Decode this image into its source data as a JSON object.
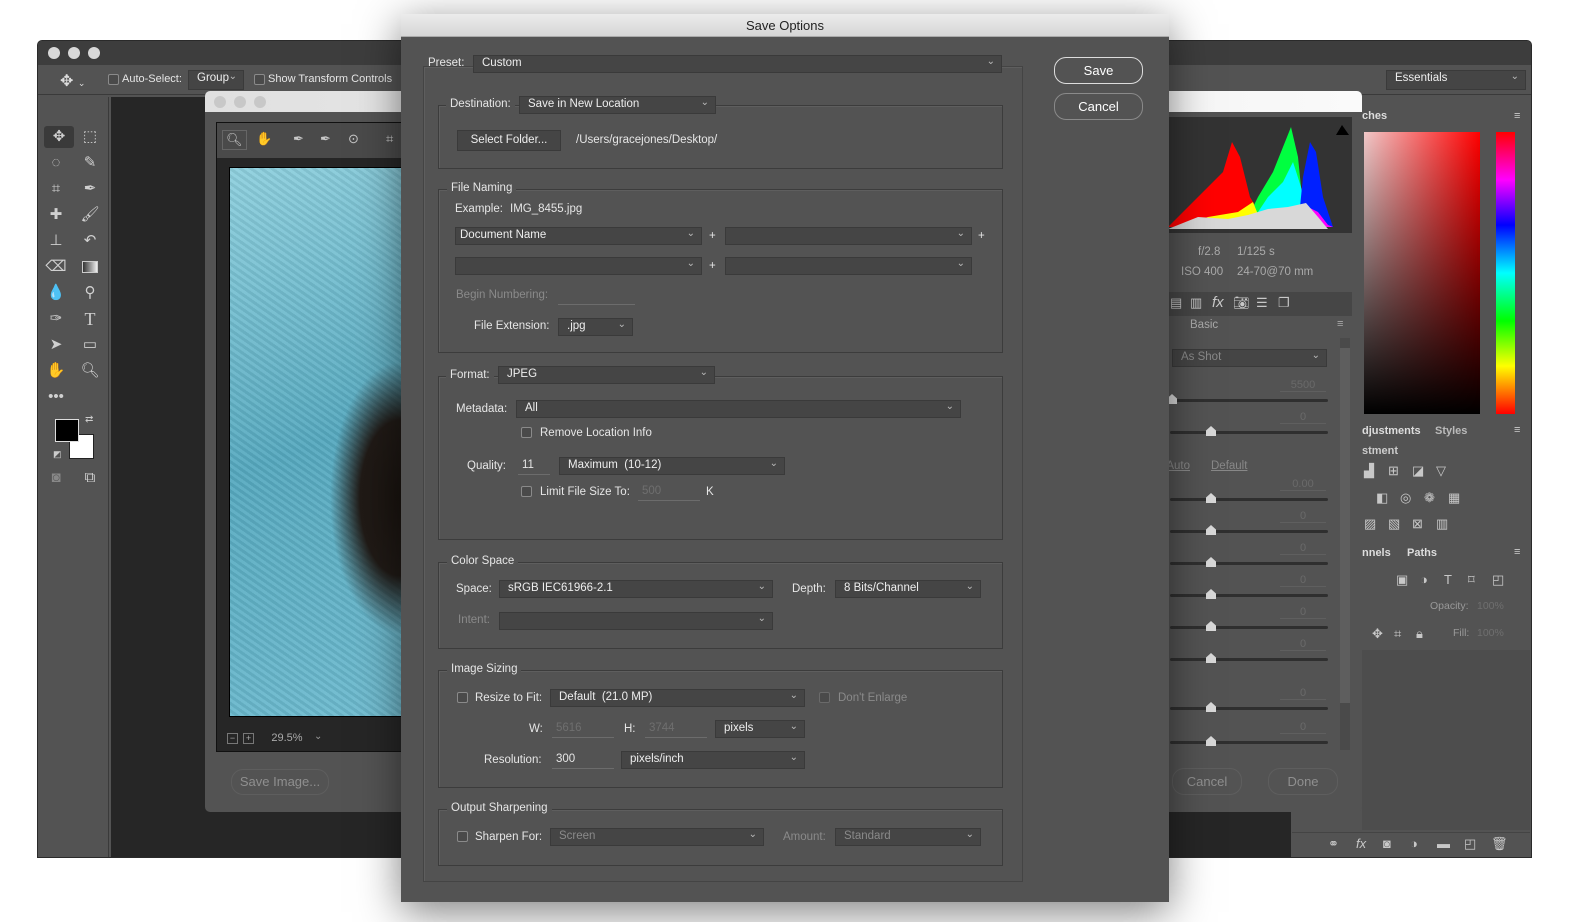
{
  "photoshop": {
    "options_bar": {
      "auto_select_label": "Auto-Select:",
      "auto_select_value": "Group",
      "show_transform_label": "Show Transform Controls",
      "workspace": "Essentials"
    },
    "colors": {
      "foreground": "#000000",
      "background": "#ffffff"
    }
  },
  "camera_raw": {
    "zoom_level": "29.5%",
    "save_image_label": "Save Image...",
    "cancel_label": "Cancel",
    "done_label": "Done",
    "exif": {
      "aperture": "f/2.8",
      "shutter": "1/125 s",
      "iso": "ISO 400",
      "lens": "24-70@70 mm"
    },
    "panel_title": "Basic",
    "white_balance": "As Shot",
    "auto_label": "Auto",
    "default_label": "Default",
    "sliders": [
      {
        "value": "5500",
        "position": 0.0
      },
      {
        "value": "0",
        "position": 0.5
      },
      {
        "value": "0.00",
        "position": 0.5
      },
      {
        "value": "0",
        "position": 0.5
      },
      {
        "value": "0",
        "position": 0.5
      },
      {
        "value": "0",
        "position": 0.5
      },
      {
        "value": "0",
        "position": 0.5
      },
      {
        "value": "0",
        "position": 0.5
      },
      {
        "value": "0",
        "position": 0.5
      },
      {
        "value": "0",
        "position": 0.5
      }
    ]
  },
  "right_panels": {
    "swatches_tab": "ches",
    "adjustments_tab": "djustments",
    "styles_tab": "Styles",
    "adjustment_heading": "stment",
    "channels_tab": "nnels",
    "paths_tab": "Paths",
    "opacity_label": "Opacity:",
    "opacity_value": "100%",
    "fill_label": "Fill:",
    "fill_value": "100%"
  },
  "dialog": {
    "title": "Save Options",
    "save_label": "Save",
    "cancel_label": "Cancel",
    "preset_label": "Preset:",
    "preset_value": "Custom",
    "destination_label": "Destination:",
    "destination_value": "Save in New Location",
    "select_folder_label": "Select Folder...",
    "folder_path": "/Users/gracejones/Desktop/",
    "file_naming": {
      "title": "File Naming",
      "example_label": "Example:",
      "example_value": "IMG_8455.jpg",
      "name_part1": "Document Name",
      "plus": "+",
      "begin_numbering_label": "Begin Numbering:",
      "file_extension_label": "File Extension:",
      "file_extension_value": ".jpg"
    },
    "format": {
      "label": "Format:",
      "value": "JPEG",
      "metadata_label": "Metadata:",
      "metadata_value": "All",
      "remove_location_label": "Remove Location Info",
      "quality_label": "Quality:",
      "quality_value": "11",
      "quality_preset": "Maximum  (10-12)",
      "limit_size_label": "Limit File Size To:",
      "limit_size_value": "500",
      "limit_size_unit": "K"
    },
    "color_space": {
      "title": "Color Space",
      "space_label": "Space:",
      "space_value": "sRGB IEC61966-2.1",
      "depth_label": "Depth:",
      "depth_value": "8 Bits/Channel",
      "intent_label": "Intent:"
    },
    "image_sizing": {
      "title": "Image Sizing",
      "resize_label": "Resize to Fit:",
      "resize_value": "Default  (21.0 MP)",
      "dont_enlarge_label": "Don't Enlarge",
      "w_label": "W:",
      "w_value": "5616",
      "h_label": "H:",
      "h_value": "3744",
      "unit_value": "pixels",
      "resolution_label": "Resolution:",
      "resolution_value": "300",
      "resolution_unit": "pixels/inch"
    },
    "output_sharpening": {
      "title": "Output Sharpening",
      "sharpen_label": "Sharpen For:",
      "sharpen_value": "Screen",
      "amount_label": "Amount:",
      "amount_value": "Standard"
    }
  }
}
